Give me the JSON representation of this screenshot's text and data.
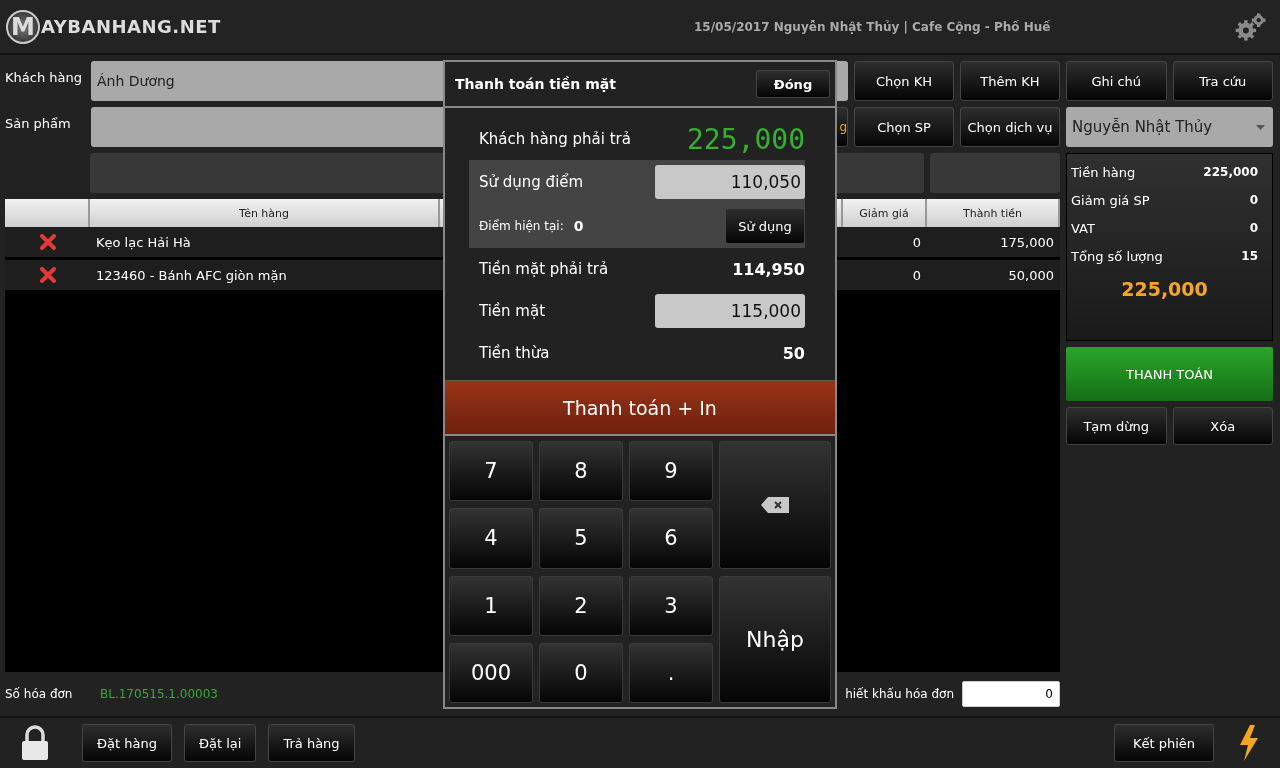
{
  "header": {
    "logo_badge": "M",
    "logo_text": "AYBANHANG.NET",
    "info": "15/05/2017  Nguyễn Nhật Thủy | Cafe Cộng - Phố Huế"
  },
  "form": {
    "customer_label": "Khách hàng",
    "customer_value": "Ánh Dương",
    "product_label": "Sản phẩm",
    "partial_button": "g",
    "row1_buttons": [
      "Chọn KH",
      "Thêm KH"
    ],
    "row2_buttons": [
      "Chọn SP",
      "Chọn dịch vụ"
    ]
  },
  "table": {
    "columns": [
      "Tên hàng",
      "Giảm giá",
      "Thành tiền"
    ],
    "rows": [
      {
        "name": "Kẹo lạc Hải Hà",
        "discount": "0",
        "total": "175,000"
      },
      {
        "name": "123460 - Bánh AFC giòn mặn",
        "discount": "0",
        "total": "50,000"
      }
    ]
  },
  "invoice": {
    "label": "Số hóa đơn",
    "number": "BL.170515.1.00003",
    "discount_label": "hiết khấu hóa đơn",
    "discount_value": "0"
  },
  "footer": {
    "left_buttons": [
      "Đặt hàng",
      "Đặt lại",
      "Trả hàng"
    ],
    "right_button": "Kết phiên"
  },
  "side": {
    "top_buttons": [
      "Ghi chú",
      "Tra cứu"
    ],
    "staff": "Nguyễn Nhật Thủy",
    "summary": [
      {
        "label": "Tiền hàng",
        "value": "225,000"
      },
      {
        "label": "Giảm giá SP",
        "value": "0"
      },
      {
        "label": "VAT",
        "value": "0"
      },
      {
        "label": "Tổng số lượng",
        "value": "15"
      }
    ],
    "total": "225,000",
    "pay_button": "THANH TOÁN",
    "bottom_buttons": [
      "Tạm dừng",
      "Xóa"
    ]
  },
  "modal": {
    "title": "Thanh toán tiền mặt",
    "close": "Đóng",
    "amount_due": {
      "label": "Khách hàng phải trả",
      "value": "225,000"
    },
    "points": {
      "label": "Sử dụng điểm",
      "value": "110,050",
      "current_label": "Điểm hiện tại:",
      "current_value": "0",
      "use_button": "Sử dụng"
    },
    "cash_due": {
      "label": "Tiền mặt phải trả",
      "value": "114,950"
    },
    "cash": {
      "label": "Tiền mặt",
      "value": "115,000"
    },
    "change": {
      "label": "Tiền thừa",
      "value": "50"
    },
    "submit": "Thanh toán + In",
    "keypad": [
      {
        "kind": "digit",
        "label": "7"
      },
      {
        "kind": "digit",
        "label": "8"
      },
      {
        "kind": "digit",
        "label": "9"
      },
      {
        "kind": "backspace"
      },
      {
        "kind": "digit",
        "label": "4"
      },
      {
        "kind": "digit",
        "label": "5"
      },
      {
        "kind": "digit",
        "label": "6"
      },
      {
        "kind": "digit",
        "label": "1"
      },
      {
        "kind": "digit",
        "label": "2"
      },
      {
        "kind": "digit",
        "label": "3"
      },
      {
        "kind": "enter",
        "label": "Nhập"
      },
      {
        "kind": "digit",
        "label": "000"
      },
      {
        "kind": "digit",
        "label": "0"
      },
      {
        "kind": "digit",
        "label": "."
      }
    ]
  }
}
